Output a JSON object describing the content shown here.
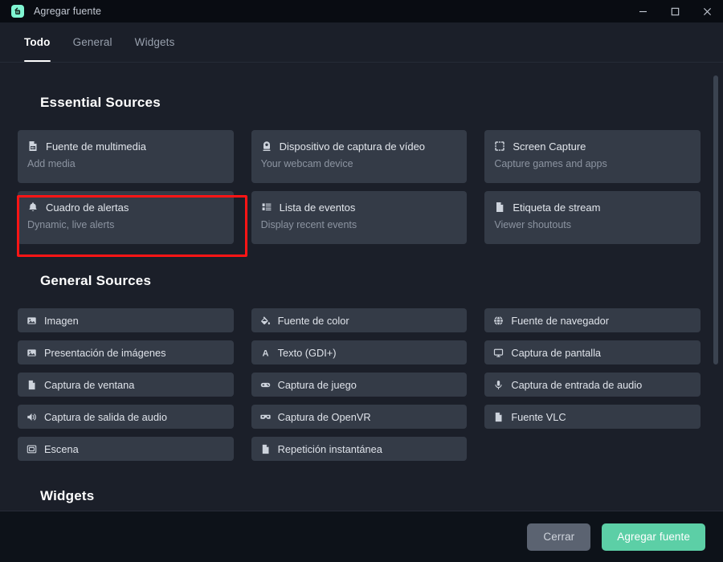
{
  "window": {
    "title": "Agregar fuente",
    "app_icon": "streamlabs-icon",
    "controls": {
      "minimize": "minimize-icon",
      "maximize": "maximize-icon",
      "close": "close-icon"
    }
  },
  "tabs": [
    {
      "label": "Todo",
      "active": true
    },
    {
      "label": "General",
      "active": false
    },
    {
      "label": "Widgets",
      "active": false
    }
  ],
  "sections": {
    "essential": {
      "title": "Essential Sources",
      "cards": [
        {
          "title": "Fuente de multimedia",
          "subtitle": "Add media",
          "icon": "file-media-icon",
          "highlighted": true
        },
        {
          "title": "Dispositivo de captura de vídeo",
          "subtitle": "Your webcam device",
          "icon": "webcam-icon",
          "highlighted": false
        },
        {
          "title": "Screen Capture",
          "subtitle": "Capture games and apps",
          "icon": "screen-capture-icon",
          "highlighted": false
        },
        {
          "title": "Cuadro de alertas",
          "subtitle": "Dynamic, live alerts",
          "icon": "bell-icon",
          "highlighted": false
        },
        {
          "title": "Lista de eventos",
          "subtitle": "Display recent events",
          "icon": "list-icon",
          "highlighted": false
        },
        {
          "title": "Etiqueta de stream",
          "subtitle": "Viewer shoutouts",
          "icon": "document-icon",
          "highlighted": false
        }
      ]
    },
    "general": {
      "title": "General Sources",
      "items": [
        {
          "label": "Imagen",
          "icon": "image-icon"
        },
        {
          "label": "Fuente de color",
          "icon": "paint-bucket-icon"
        },
        {
          "label": "Fuente de navegador",
          "icon": "globe-icon"
        },
        {
          "label": "Presentación de imágenes",
          "icon": "image-icon"
        },
        {
          "label": "Texto (GDI+)",
          "icon": "text-a-icon"
        },
        {
          "label": "Captura de pantalla",
          "icon": "monitor-icon"
        },
        {
          "label": "Captura de ventana",
          "icon": "document-icon"
        },
        {
          "label": "Captura de juego",
          "icon": "gamepad-icon"
        },
        {
          "label": "Captura de entrada de audio",
          "icon": "microphone-icon"
        },
        {
          "label": "Captura de salida de audio",
          "icon": "speaker-icon"
        },
        {
          "label": "Captura de OpenVR",
          "icon": "vr-headset-icon"
        },
        {
          "label": "Fuente VLC",
          "icon": "document-icon"
        },
        {
          "label": "Escena",
          "icon": "scene-icon"
        },
        {
          "label": "Repetición instantánea",
          "icon": "document-icon"
        }
      ]
    },
    "widgets": {
      "title": "Widgets"
    }
  },
  "footer": {
    "close_label": "Cerrar",
    "add_label": "Agregar fuente"
  },
  "colors": {
    "accent": "#5ccfa6",
    "highlight": "#ff1515",
    "card_bg": "#343b47",
    "page_bg": "#1b1f29",
    "titlebar_bg": "#090c12",
    "footer_bg": "#0d1219"
  },
  "scrollbar": {
    "thumb_top_pct": 3,
    "thumb_height_pct": 67
  }
}
